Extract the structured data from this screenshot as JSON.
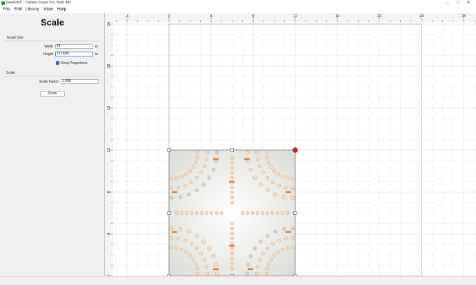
{
  "window": {
    "title": "[NewFile]* - Carbide Create Pro, Build 843",
    "minimize": "–",
    "maximize": "□",
    "close": "✕"
  },
  "menu": [
    "File",
    "Edit",
    "Library",
    "View",
    "Help"
  ],
  "panel": {
    "title": "Scale",
    "target_size": {
      "section": "Target Size",
      "width_label": "Width",
      "width_value": "24",
      "width_unit": "in",
      "height_label": "Height",
      "height_value": "12.0000",
      "height_unit": "in",
      "keep_proportions": "Keep Proportions",
      "keep_proportions_checked": true
    },
    "scale": {
      "section": "Scale",
      "factor_label": "Scale Factor",
      "factor_value": "1.000"
    },
    "done": "Done"
  },
  "ruler": {
    "x_ticks": [
      "-4",
      "0",
      "4",
      "8",
      "12",
      "16",
      "20",
      "24",
      "28"
    ],
    "y_ticks": [
      "24",
      "20",
      "16",
      "12",
      "8",
      "4",
      "0"
    ]
  },
  "colors": {
    "accent": "#1f5fbf",
    "design_orange": "#e07a2a",
    "selection_handle": "#c62828"
  }
}
